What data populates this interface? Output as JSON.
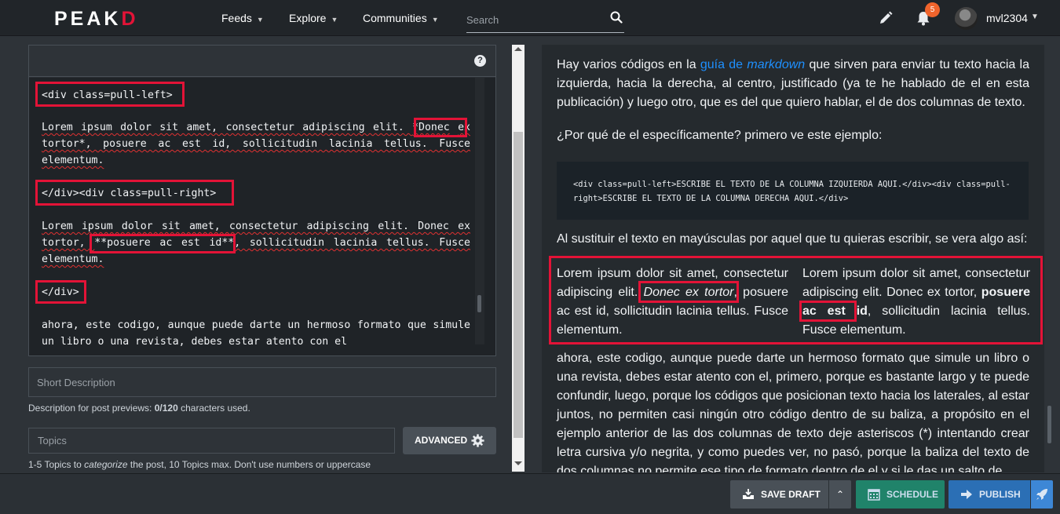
{
  "navbar": {
    "logo": "PEAKD",
    "links": [
      {
        "label": "Feeds"
      },
      {
        "label": "Explore"
      },
      {
        "label": "Communities"
      }
    ],
    "search_placeholder": "Search",
    "notification_count": "5",
    "username": "mvl2304"
  },
  "editor": {
    "help_label": "?",
    "lines": {
      "div_left": "<div class=pull-left>",
      "para1_a": "Lorem ipsum dolor sit amet, consectetur adipiscing elit. ",
      "para1_b": "*Donec",
      "para1_c": "ex tortor*, posuere ac est id, sollicitudin lacinia tellus. Fusce elementum.",
      "div_right": "</div><div class=pull-right>",
      "para2_a": "Lorem ipsum dolor sit amet, consectetur adipiscing elit. Donec ex tortor, ",
      "para2_b": "**posuere ac est id**",
      "para2_c": ", sollicitudin lacinia tellus. Fusce elementum.",
      "div_close": "</div>",
      "para3": "ahora, este codigo, aunque puede darte un hermoso formato que simule un libro o una revista, debes estar atento con el"
    }
  },
  "short_description": {
    "placeholder": "Short Description",
    "help_prefix": "Description for post previews: ",
    "help_count": "0/120",
    "help_suffix": " characters used."
  },
  "topics": {
    "placeholder": "Topics",
    "help_prefix": "1-5 Topics to ",
    "help_em": "categorize",
    "help_suffix": " the post, 10 Topics max. Don't use numbers or uppercase",
    "advanced_label": "ADVANCED"
  },
  "preview": {
    "p1_a": "Hay varios códigos en la ",
    "p1_link_a": "guía de ",
    "p1_link_b": "markdown",
    "p1_b": " que sirven para enviar tu texto hacia la izquierda, hacia la derecha, al centro, justificado (ya te he hablado de el en esta publicación) y luego otro, que es del que quiero hablar, el de dos columnas de texto.",
    "p2": "¿Por qué de el específicamente? primero ve este ejemplo:",
    "code": "<div class=pull-left>ESCRIBE EL TEXTO DE LA COLUMNA IZQUIERDA AQUI.</div><div class=pull-right>ESCRIBE EL TEXTO DE LA COLUMNA DERECHA AQUI.</div>",
    "p3": "Al sustituir el texto en mayúsculas por aquel que tu quieras escribir, se vera algo así:",
    "col_left_a": "Lorem ipsum dolor sit amet, consectetur adipiscing elit. ",
    "col_left_em": "Donec ex tortor",
    "col_left_b": ", posuere ac est id, sollicitudin lacinia tellus. Fusce elementum.",
    "col_right_a": "Lorem ipsum dolor sit amet, consectetur adipiscing elit. Donec ex tortor, ",
    "col_right_strong": "posuere ac est id",
    "col_right_b": ", sollicitudin lacinia tellus. Fusce elementum.",
    "p4": "ahora, este codigo, aunque puede darte un hermoso formato que simule un libro o una revista, debes estar atento con el, primero, porque es bastante largo y te puede confundir, luego, porque los códigos que posicionan texto hacia los laterales, al estar juntos, no permiten casi ningún otro código dentro de su baliza, a propósito en el ejemplo anterior de las dos columnas de texto deje asteriscos (*) intentando crear letra cursiva y/o negrita, y como puedes ver, no pasó, porque la baliza del texto de dos columnas no permite ese tipo de formato dentro de el y si le das un salto de"
  },
  "actions": {
    "save_draft": "SAVE DRAFT",
    "schedule": "SCHEDULE",
    "publish": "PUBLISH"
  },
  "colors": {
    "brand_red": "#e31337",
    "schedule_green": "#20836a",
    "publish_blue": "#2b6fb5",
    "link_blue": "#1e90ff"
  }
}
